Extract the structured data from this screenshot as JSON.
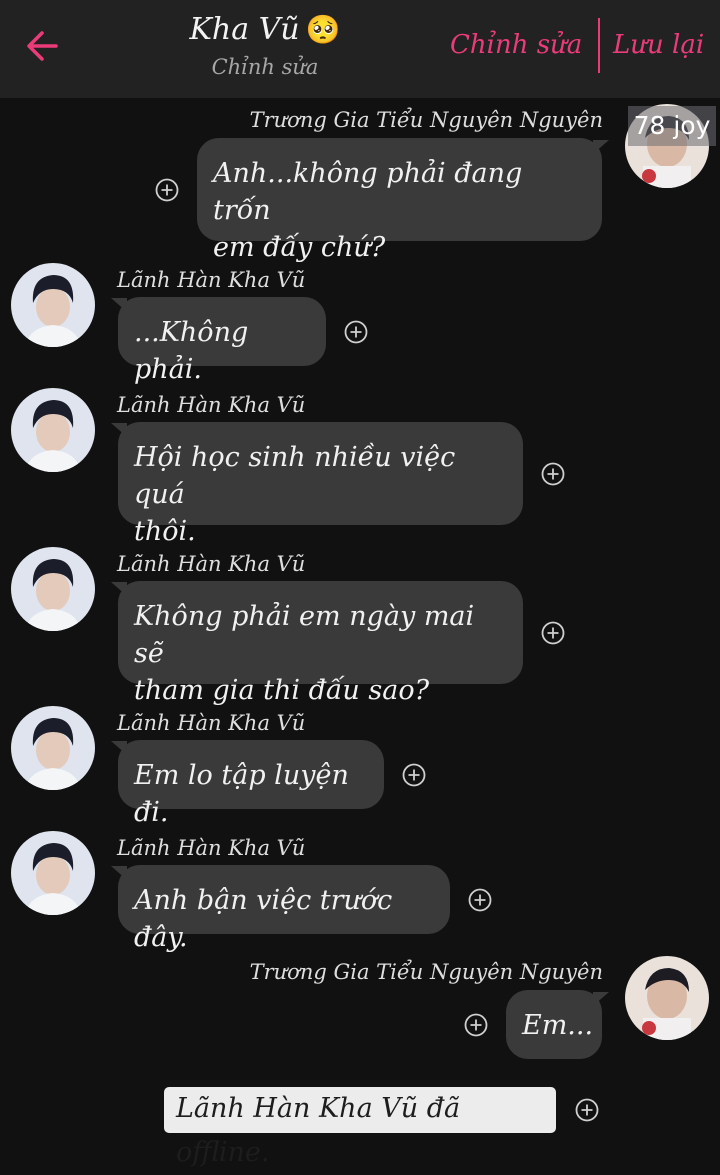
{
  "header": {
    "title": "Kha Vũ",
    "emoji": "🥺",
    "subtitle": "Chỉnh sửa",
    "edit_label": "Chỉnh sửa",
    "save_label": "Lưu lại",
    "accent_color": "#ec3b79"
  },
  "overlay_tag": "78 joy",
  "messages": [
    {
      "sender": "Trương Gia Tiểu Nguyên Nguyên",
      "side": "right",
      "lines": [
        "Anh...không phải đang trốn",
        "em đấy chứ?"
      ]
    },
    {
      "sender": "Lãnh Hàn Kha Vũ",
      "side": "left",
      "lines": [
        "...Không phải."
      ]
    },
    {
      "sender": "Lãnh Hàn Kha Vũ",
      "side": "left",
      "lines": [
        "Hội học sinh nhiều việc quá",
        "thôi."
      ]
    },
    {
      "sender": "Lãnh Hàn Kha Vũ",
      "side": "left",
      "lines": [
        "Không phải em ngày mai sẽ",
        "tham gia thi đấu sao?"
      ]
    },
    {
      "sender": "Lãnh Hàn Kha Vũ",
      "side": "left",
      "lines": [
        "Em lo tập luyện đi."
      ]
    },
    {
      "sender": "Lãnh Hàn Kha Vũ",
      "side": "left",
      "lines": [
        "Anh bận việc trước đây."
      ]
    },
    {
      "sender": "Trương Gia Tiểu Nguyên Nguyên",
      "side": "right",
      "lines": [
        "Em..."
      ]
    }
  ],
  "system_message": "Lãnh Hàn Kha Vũ đã offline.",
  "icons": {
    "back": "arrow-left-icon",
    "add": "plus-circle-icon"
  }
}
